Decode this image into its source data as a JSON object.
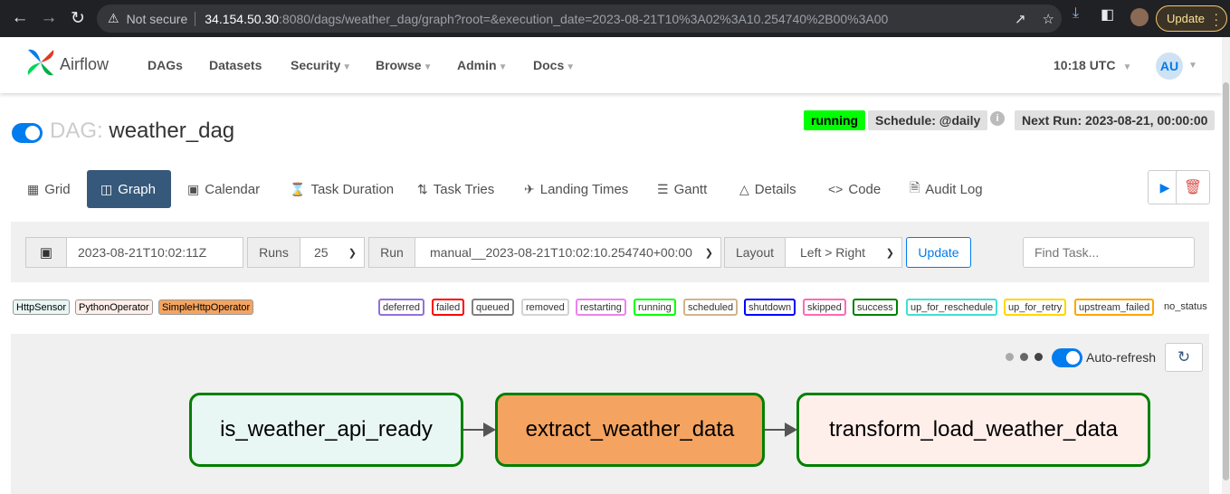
{
  "browser": {
    "not_secure": "Not secure",
    "url_host": "34.154.50.30",
    "url_rest": ":8080/dags/weather_dag/graph?root=&execution_date=2023-08-21T10%3A02%3A10.254740%2B00%3A00",
    "update_label": "Update"
  },
  "navbar": {
    "brand": "Airflow",
    "menu": [
      "DAGs",
      "Datasets",
      "Security",
      "Browse",
      "Admin",
      "Docs"
    ],
    "time": "10:18 UTC",
    "user_initials": "AU"
  },
  "dag": {
    "label": "DAG:",
    "name": "weather_dag",
    "state": "running",
    "schedule": "Schedule: @daily",
    "next_run": "Next Run: 2023-08-21, 00:00:00"
  },
  "tabs": [
    "Grid",
    "Graph",
    "Calendar",
    "Task Duration",
    "Task Tries",
    "Landing Times",
    "Gantt",
    "Details",
    "Code",
    "Audit Log"
  ],
  "active_tab": "Graph",
  "filters": {
    "base_date": "2023-08-21T10:02:11Z",
    "runs_label": "Runs",
    "runs_value": "25",
    "run_label": "Run",
    "run_value": "manual__2023-08-21T10:02:10.254740+00:00",
    "layout_label": "Layout",
    "layout_value": "Left > Right",
    "update_label": "Update",
    "find_placeholder": "Find Task..."
  },
  "operators": [
    {
      "label": "HttpSensor",
      "color": "#e8f7f4"
    },
    {
      "label": "PythonOperator",
      "color": "#ffefeb"
    },
    {
      "label": "SimpleHttpOperator",
      "color": "#f4a460"
    }
  ],
  "states": [
    {
      "label": "deferred",
      "color": "#9370db"
    },
    {
      "label": "failed",
      "color": "#ff0000"
    },
    {
      "label": "queued",
      "color": "#808080"
    },
    {
      "label": "removed",
      "color": "#d3d3d3"
    },
    {
      "label": "restarting",
      "color": "#ee82ee"
    },
    {
      "label": "running",
      "color": "#00ff00"
    },
    {
      "label": "scheduled",
      "color": "#d2b48c"
    },
    {
      "label": "shutdown",
      "color": "#0000ff"
    },
    {
      "label": "skipped",
      "color": "#ff69b4"
    },
    {
      "label": "success",
      "color": "#008000"
    },
    {
      "label": "up_for_reschedule",
      "color": "#40e0d0"
    },
    {
      "label": "up_for_retry",
      "color": "#ffd700"
    },
    {
      "label": "upstream_failed",
      "color": "#ffa500"
    }
  ],
  "no_status": "no_status",
  "graph": {
    "auto_refresh_label": "Auto-refresh",
    "nodes": [
      {
        "label": "is_weather_api_ready",
        "fill": "#e8f7f4"
      },
      {
        "label": "extract_weather_data",
        "fill": "#f4a460"
      },
      {
        "label": "transform_load_weather_data",
        "fill": "#ffefeb"
      }
    ]
  }
}
